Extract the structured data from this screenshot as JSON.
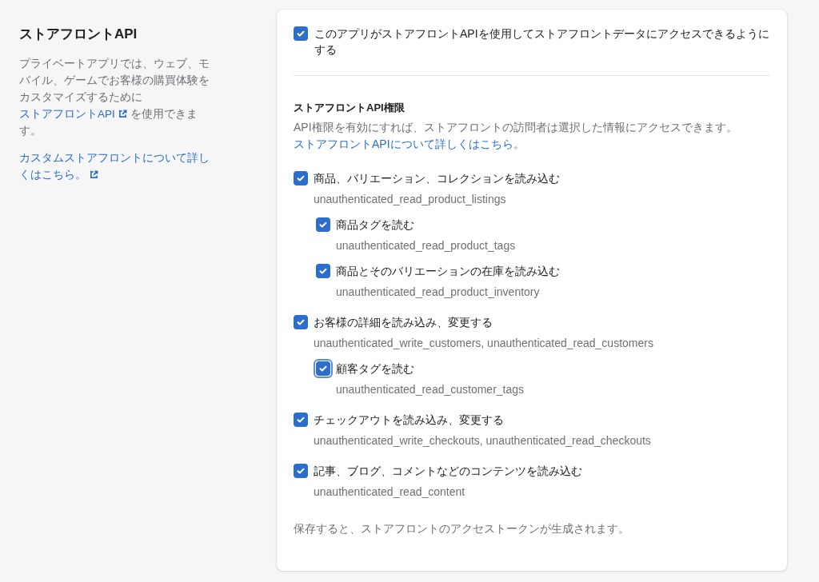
{
  "sidebar": {
    "title": "ストアフロントAPI",
    "description": {
      "before": "プライベートアプリでは、ウェブ、モバイル、ゲームでお客様の購買体験をカスタマイズするために",
      "link": "ストアフロントAPI",
      "after": "を使用できます。"
    },
    "learn_more_link": "カスタムストアフロントについて詳しくはこちら。"
  },
  "card": {
    "enable": {
      "label": "このアプリがストアフロントAPIを使用してストアフロントデータにアクセスできるようにする",
      "checked": true
    },
    "permissions_title": "ストアフロントAPI権限",
    "permissions_description": {
      "text": "API権限を有効にすれば、ストアフロントの訪問者は選択した情報にアクセスできます。",
      "link": "ストアフロントAPIについて詳しくはこちら。"
    },
    "permissions": [
      {
        "label": "商品、バリエーション、コレクションを読み込む",
        "scope": "unauthenticated_read_product_listings",
        "checked": true,
        "focused": false,
        "children": [
          {
            "label": "商品タグを読む",
            "scope": "unauthenticated_read_product_tags",
            "checked": true,
            "focused": false
          },
          {
            "label": "商品とそのバリエーションの在庫を読み込む",
            "scope": "unauthenticated_read_product_inventory",
            "checked": true,
            "focused": false
          }
        ]
      },
      {
        "label": "お客様の詳細を読み込み、変更する",
        "scope": "unauthenticated_write_customers, unauthenticated_read_customers",
        "checked": true,
        "focused": false,
        "children": [
          {
            "label": "顧客タグを読む",
            "scope": "unauthenticated_read_customer_tags",
            "checked": true,
            "focused": true
          }
        ]
      },
      {
        "label": "チェックアウトを読み込み、変更する",
        "scope": "unauthenticated_write_checkouts, unauthenticated_read_checkouts",
        "checked": true,
        "focused": false
      },
      {
        "label": "記事、ブログ、コメントなどのコンテンツを読み込む",
        "scope": "unauthenticated_read_content",
        "checked": true,
        "focused": false
      }
    ],
    "footer": "保存すると、ストアフロントのアクセストークンが生成されます。"
  }
}
